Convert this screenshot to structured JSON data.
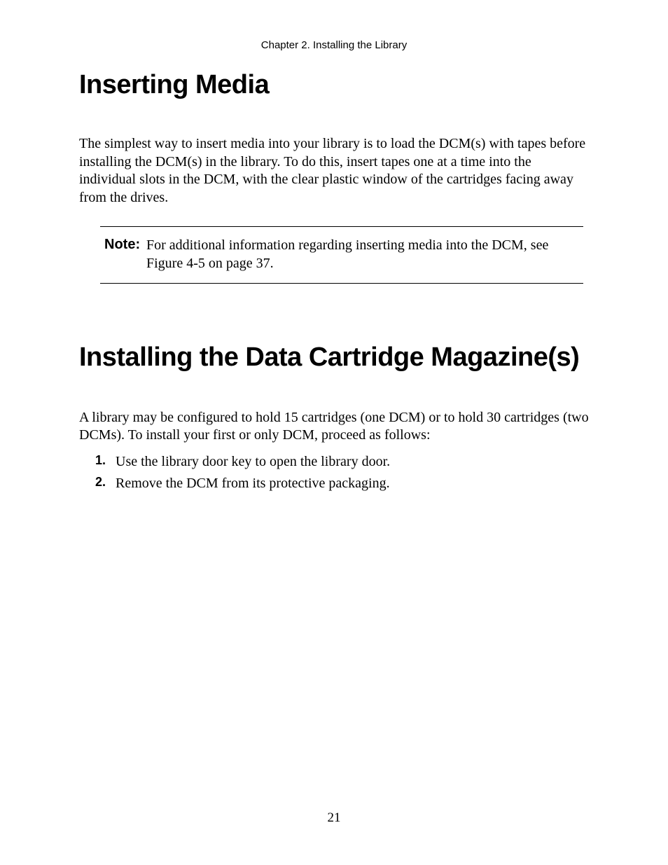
{
  "runningHead": "Chapter 2.  Installing the Library",
  "section1": {
    "title": "Inserting Media",
    "para": "The simplest way to insert media into your library is to load the DCM(s) with tapes before installing the DCM(s) in the library. To do this, insert tapes one at a time into the individual slots in the DCM, with the clear plastic window of the cartridges facing away from the drives."
  },
  "note": {
    "label": "Note:",
    "text": "For additional information regarding inserting media into the DCM, see Figure 4-5 on page 37."
  },
  "section2": {
    "title": "Installing the Data Cartridge Magazine(s)",
    "para": "A library may be configured to hold 15 cartridges (one DCM) or to hold 30 cartridges (two DCMs). To install your first or only DCM, proceed as follows:",
    "steps": [
      {
        "num": "1.",
        "text": "Use the library door key to open the library door."
      },
      {
        "num": "2.",
        "text": "Remove the DCM from its protective packaging."
      }
    ]
  },
  "pageNumber": "21"
}
